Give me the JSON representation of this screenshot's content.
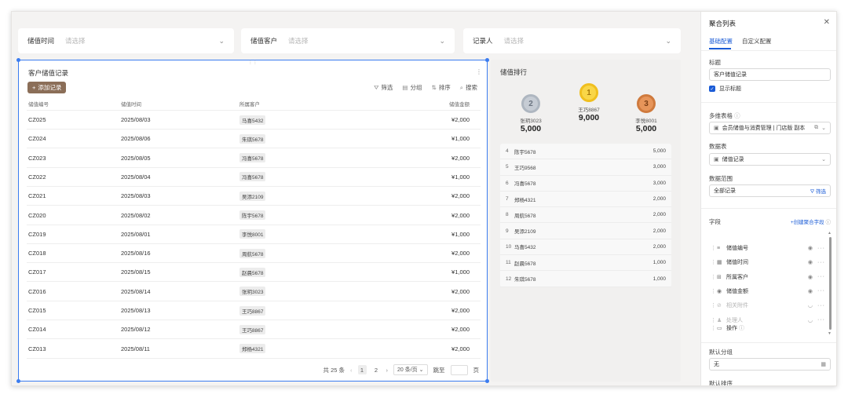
{
  "filters": [
    {
      "label": "储值时间",
      "placeholder": "请选择"
    },
    {
      "label": "储值客户",
      "placeholder": "请选择"
    },
    {
      "label": "记录人",
      "placeholder": "请选择"
    }
  ],
  "table": {
    "title": "客户储值记录",
    "add_label": "添加记录",
    "tools": [
      "筛选",
      "分组",
      "排序",
      "搜索"
    ],
    "columns": [
      "储值编号",
      "储值时间",
      "所属客户",
      "储值金额"
    ],
    "rows": [
      [
        "CZ025",
        "2025/08/03",
        "马喜5432",
        "¥2,000"
      ],
      [
        "CZ024",
        "2025/08/06",
        "朱琪5678",
        "¥1,000"
      ],
      [
        "CZ023",
        "2025/08/05",
        "冯喜5678",
        "¥2,000"
      ],
      [
        "CZ022",
        "2025/08/04",
        "冯喜5678",
        "¥1,000"
      ],
      [
        "CZ021",
        "2025/08/03",
        "吴添2109",
        "¥2,000"
      ],
      [
        "CZ020",
        "2025/08/02",
        "陈宇5678",
        "¥2,000"
      ],
      [
        "CZ019",
        "2025/08/01",
        "李悦8001",
        "¥1,000"
      ],
      [
        "CZ018",
        "2025/08/16",
        "周航5678",
        "¥2,000"
      ],
      [
        "CZ017",
        "2025/08/15",
        "赵晨5678",
        "¥1,000"
      ],
      [
        "CZ016",
        "2025/08/14",
        "张玥3023",
        "¥2,000"
      ],
      [
        "CZ015",
        "2025/08/13",
        "王巧8867",
        "¥2,000"
      ],
      [
        "CZ014",
        "2025/08/12",
        "王巧8867",
        "¥2,000"
      ],
      [
        "CZ013",
        "2025/08/11",
        "郑杨4321",
        "¥2,000"
      ]
    ],
    "pager": {
      "total": "共 25 条",
      "pages": [
        "1",
        "2"
      ],
      "page_size": "20 条/页",
      "jump_label": "跳至",
      "page_unit": "页"
    }
  },
  "ranking": {
    "title": "储值排行",
    "podium": [
      {
        "rank": "2",
        "name": "张玥3023",
        "value": "5,000",
        "color": "#b9c2cc"
      },
      {
        "rank": "1",
        "name": "王巧8867",
        "value": "9,000",
        "color": "#f4c430"
      },
      {
        "rank": "3",
        "name": "李悦8001",
        "value": "5,000",
        "color": "#d9844a"
      }
    ],
    "list": [
      [
        "4",
        "陈宇5678",
        "5,000"
      ],
      [
        "5",
        "王巧9568",
        "3,000"
      ],
      [
        "6",
        "冯喜5678",
        "3,000"
      ],
      [
        "7",
        "郑杨4321",
        "2,000"
      ],
      [
        "8",
        "周航5678",
        "2,000"
      ],
      [
        "9",
        "吴添2109",
        "2,000"
      ],
      [
        "10",
        "马喜5432",
        "2,000"
      ],
      [
        "11",
        "赵晨5678",
        "1,000"
      ],
      [
        "12",
        "朱琪5678",
        "1,000"
      ]
    ]
  },
  "panel": {
    "title": "聚合列表",
    "tabs": [
      "基础配置",
      "自定义配置"
    ],
    "title_label": "标题",
    "title_value": "客户储值记录",
    "show_title": "显示标题",
    "multi_table_label": "多维表格",
    "multi_table_value": "会员储值与消费管理 | 门店版 副本",
    "datatable_label": "数据表",
    "datatable_value": "储值记录",
    "range_label": "数据范围",
    "range_value": "全部记录",
    "range_filter": "筛选",
    "fields_label": "字段",
    "add_field": "+创建聚合字段",
    "fields": [
      {
        "name": "储值编号",
        "icon": "≡",
        "dim": false
      },
      {
        "name": "储值时间",
        "icon": "▦",
        "dim": false
      },
      {
        "name": "所属客户",
        "icon": "⊞",
        "dim": false
      },
      {
        "name": "储值金额",
        "icon": "◉",
        "dim": false
      },
      {
        "name": "相关附件",
        "icon": "⊘",
        "dim": true
      },
      {
        "name": "处理人",
        "icon": "♟",
        "dim": true
      }
    ],
    "ops_label": "操作",
    "group_label": "默认分组",
    "group_value": "无",
    "sort_label": "默认排序"
  }
}
